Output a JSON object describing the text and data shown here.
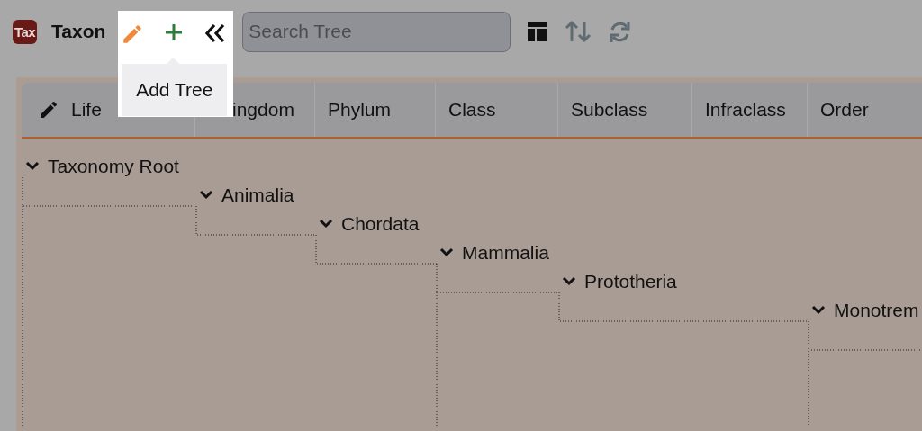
{
  "app": {
    "logo": "Tax",
    "title": "Taxon"
  },
  "toolbar": {
    "tooltip": "Add Tree",
    "search": {
      "placeholder": "Search Tree"
    }
  },
  "columns": [
    {
      "label": "Life",
      "icon": true
    },
    {
      "label": "ingdom",
      "icon": false
    },
    {
      "label": "Phylum",
      "icon": false
    },
    {
      "label": "Class",
      "icon": false
    },
    {
      "label": "Subclass",
      "icon": false
    },
    {
      "label": "Infraclass",
      "icon": false
    },
    {
      "label": "Order",
      "icon": false
    }
  ],
  "tree": [
    {
      "name": "Taxonomy Root",
      "expanded": true,
      "more_children": true,
      "children": [
        {
          "name": "Animalia",
          "expanded": true,
          "more_children": false,
          "children": [
            {
              "name": "Chordata",
              "expanded": true,
              "more_children": false,
              "children": [
                {
                  "name": "Mammalia",
                  "expanded": true,
                  "more_children": true,
                  "children": [
                    {
                      "name": "Prototheria",
                      "expanded": true,
                      "more_children": false,
                      "children": [
                        {
                          "name": "Monotrem",
                          "expanded": true,
                          "more_children": true,
                          "skips_rank": true
                        }
                      ]
                    }
                  ]
                }
              ]
            }
          ]
        }
      ]
    }
  ]
}
